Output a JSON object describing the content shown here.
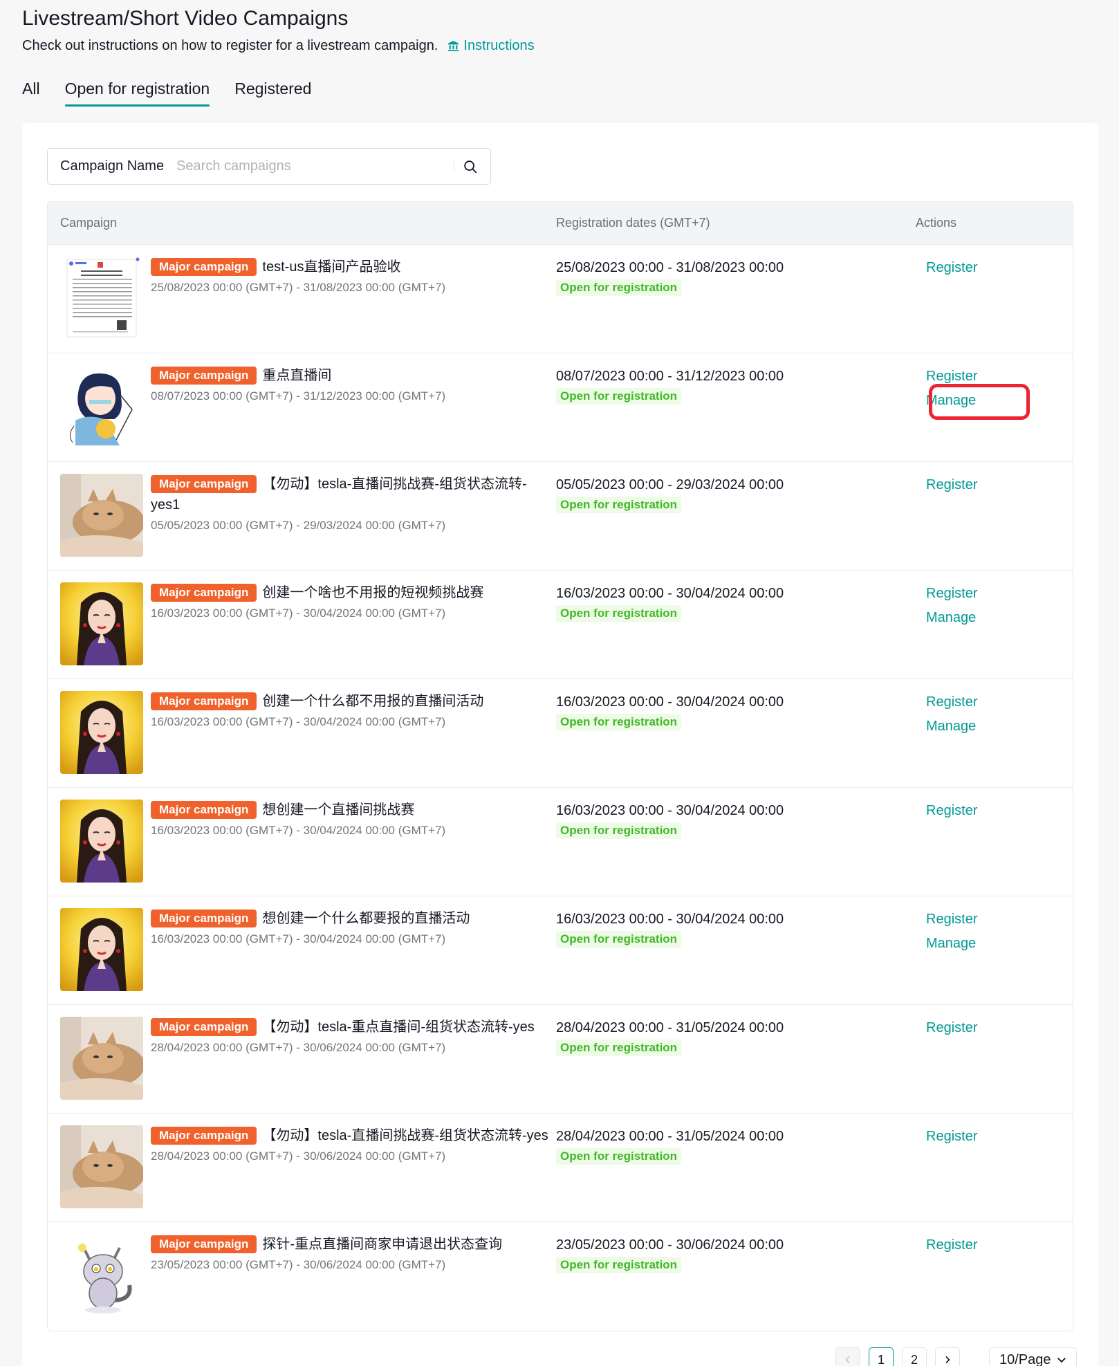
{
  "page": {
    "title": "Livestream/Short Video Campaigns",
    "subtitle": "Check out instructions on how to register for a livestream campaign.",
    "instructions_link": "Instructions"
  },
  "tabs": [
    {
      "label": "All",
      "active": false
    },
    {
      "label": "Open for registration",
      "active": true
    },
    {
      "label": "Registered",
      "active": false
    }
  ],
  "search": {
    "label": "Campaign Name",
    "placeholder": "Search campaigns"
  },
  "table": {
    "headers": {
      "campaign": "Campaign",
      "dates": "Registration dates (GMT+7)",
      "actions": "Actions"
    },
    "badge_label": "Major campaign",
    "rows": [
      {
        "thumb": "doc",
        "name": "test-us直播间产品验收",
        "camp_dates": "25/08/2023 00:00 (GMT+7) - 31/08/2023 00:00 (GMT+7)",
        "reg_dates": "25/08/2023 00:00 - 31/08/2023 00:00",
        "status": "Open for registration",
        "register": "Register",
        "manage": null
      },
      {
        "thumb": "anime",
        "name": "重点直播间",
        "camp_dates": "08/07/2023 00:00 (GMT+7) - 31/12/2023 00:00 (GMT+7)",
        "reg_dates": "08/07/2023 00:00 - 31/12/2023 00:00",
        "status": "Open for registration",
        "register": "Register",
        "manage": "Manage"
      },
      {
        "thumb": "cat",
        "name": "【勿动】tesla-直播间挑战赛-组货状态流转-yes1",
        "camp_dates": "05/05/2023 00:00 (GMT+7) - 29/03/2024 00:00 (GMT+7)",
        "reg_dates": "05/05/2023 00:00 - 29/03/2024 00:00",
        "status": "Open for registration",
        "register": "Register",
        "manage": null
      },
      {
        "thumb": "girl",
        "name": "创建一个啥也不用报的短视频挑战赛",
        "camp_dates": "16/03/2023 00:00 (GMT+7) - 30/04/2024 00:00 (GMT+7)",
        "reg_dates": "16/03/2023 00:00 - 30/04/2024 00:00",
        "status": "Open for registration",
        "register": "Register",
        "manage": "Manage"
      },
      {
        "thumb": "girl",
        "name": "创建一个什么都不用报的直播间活动",
        "camp_dates": "16/03/2023 00:00 (GMT+7) - 30/04/2024 00:00 (GMT+7)",
        "reg_dates": "16/03/2023 00:00 - 30/04/2024 00:00",
        "status": "Open for registration",
        "register": "Register",
        "manage": "Manage"
      },
      {
        "thumb": "girl",
        "name": "想创建一个直播间挑战赛",
        "camp_dates": "16/03/2023 00:00 (GMT+7) - 30/04/2024 00:00 (GMT+7)",
        "reg_dates": "16/03/2023 00:00 - 30/04/2024 00:00",
        "status": "Open for registration",
        "register": "Register",
        "manage": null
      },
      {
        "thumb": "girl",
        "name": "想创建一个什么都要报的直播活动",
        "camp_dates": "16/03/2023 00:00 (GMT+7) - 30/04/2024 00:00 (GMT+7)",
        "reg_dates": "16/03/2023 00:00 - 30/04/2024 00:00",
        "status": "Open for registration",
        "register": "Register",
        "manage": "Manage"
      },
      {
        "thumb": "cat",
        "name": "【勿动】tesla-重点直播间-组货状态流转-yes",
        "camp_dates": "28/04/2023 00:00 (GMT+7) - 30/06/2024 00:00 (GMT+7)",
        "reg_dates": "28/04/2023 00:00 - 31/05/2024 00:00",
        "status": "Open for registration",
        "register": "Register",
        "manage": null
      },
      {
        "thumb": "cat",
        "name": "【勿动】tesla-直播间挑战赛-组货状态流转-yes",
        "camp_dates": "28/04/2023 00:00 (GMT+7) - 30/06/2024 00:00 (GMT+7)",
        "reg_dates": "28/04/2023 00:00 - 31/05/2024 00:00",
        "status": "Open for registration",
        "register": "Register",
        "manage": null
      },
      {
        "thumb": "cartoon",
        "name": "探针-重点直播间商家申请退出状态查询",
        "camp_dates": "23/05/2023 00:00 (GMT+7) - 30/06/2024 00:00 (GMT+7)",
        "reg_dates": "23/05/2023 00:00 - 30/06/2024 00:00",
        "status": "Open for registration",
        "register": "Register",
        "manage": null
      }
    ]
  },
  "pagination": {
    "pages": [
      "1",
      "2"
    ],
    "current": "1",
    "page_size": "10/Page"
  },
  "colors": {
    "accent": "#009995",
    "badge": "#f0612b",
    "status_text": "#41b82a",
    "status_bg": "#eefbe6",
    "highlight": "#ee2331"
  }
}
